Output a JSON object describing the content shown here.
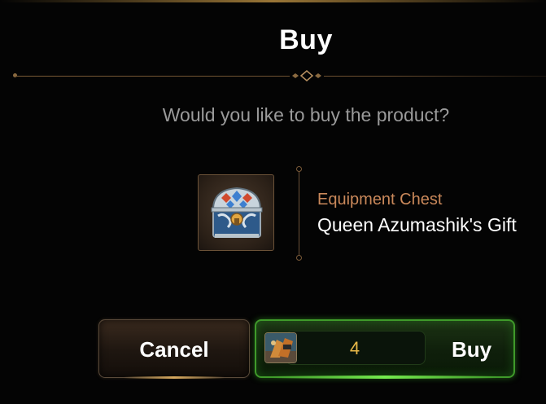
{
  "dialog": {
    "title": "Buy",
    "question": "Would you like to buy the product?"
  },
  "product": {
    "category": "Equipment Chest",
    "name": "Queen Azumashik's Gift",
    "icon": "chest-icon"
  },
  "buttons": {
    "cancel_label": "Cancel",
    "buy_label": "Buy",
    "price": "4",
    "currency_icon": "currency-item-icon"
  },
  "colors": {
    "category_text": "#c9885a",
    "price_text": "#e8b848",
    "buy_border": "#3f9a2a",
    "divider": "#7a5a35"
  }
}
